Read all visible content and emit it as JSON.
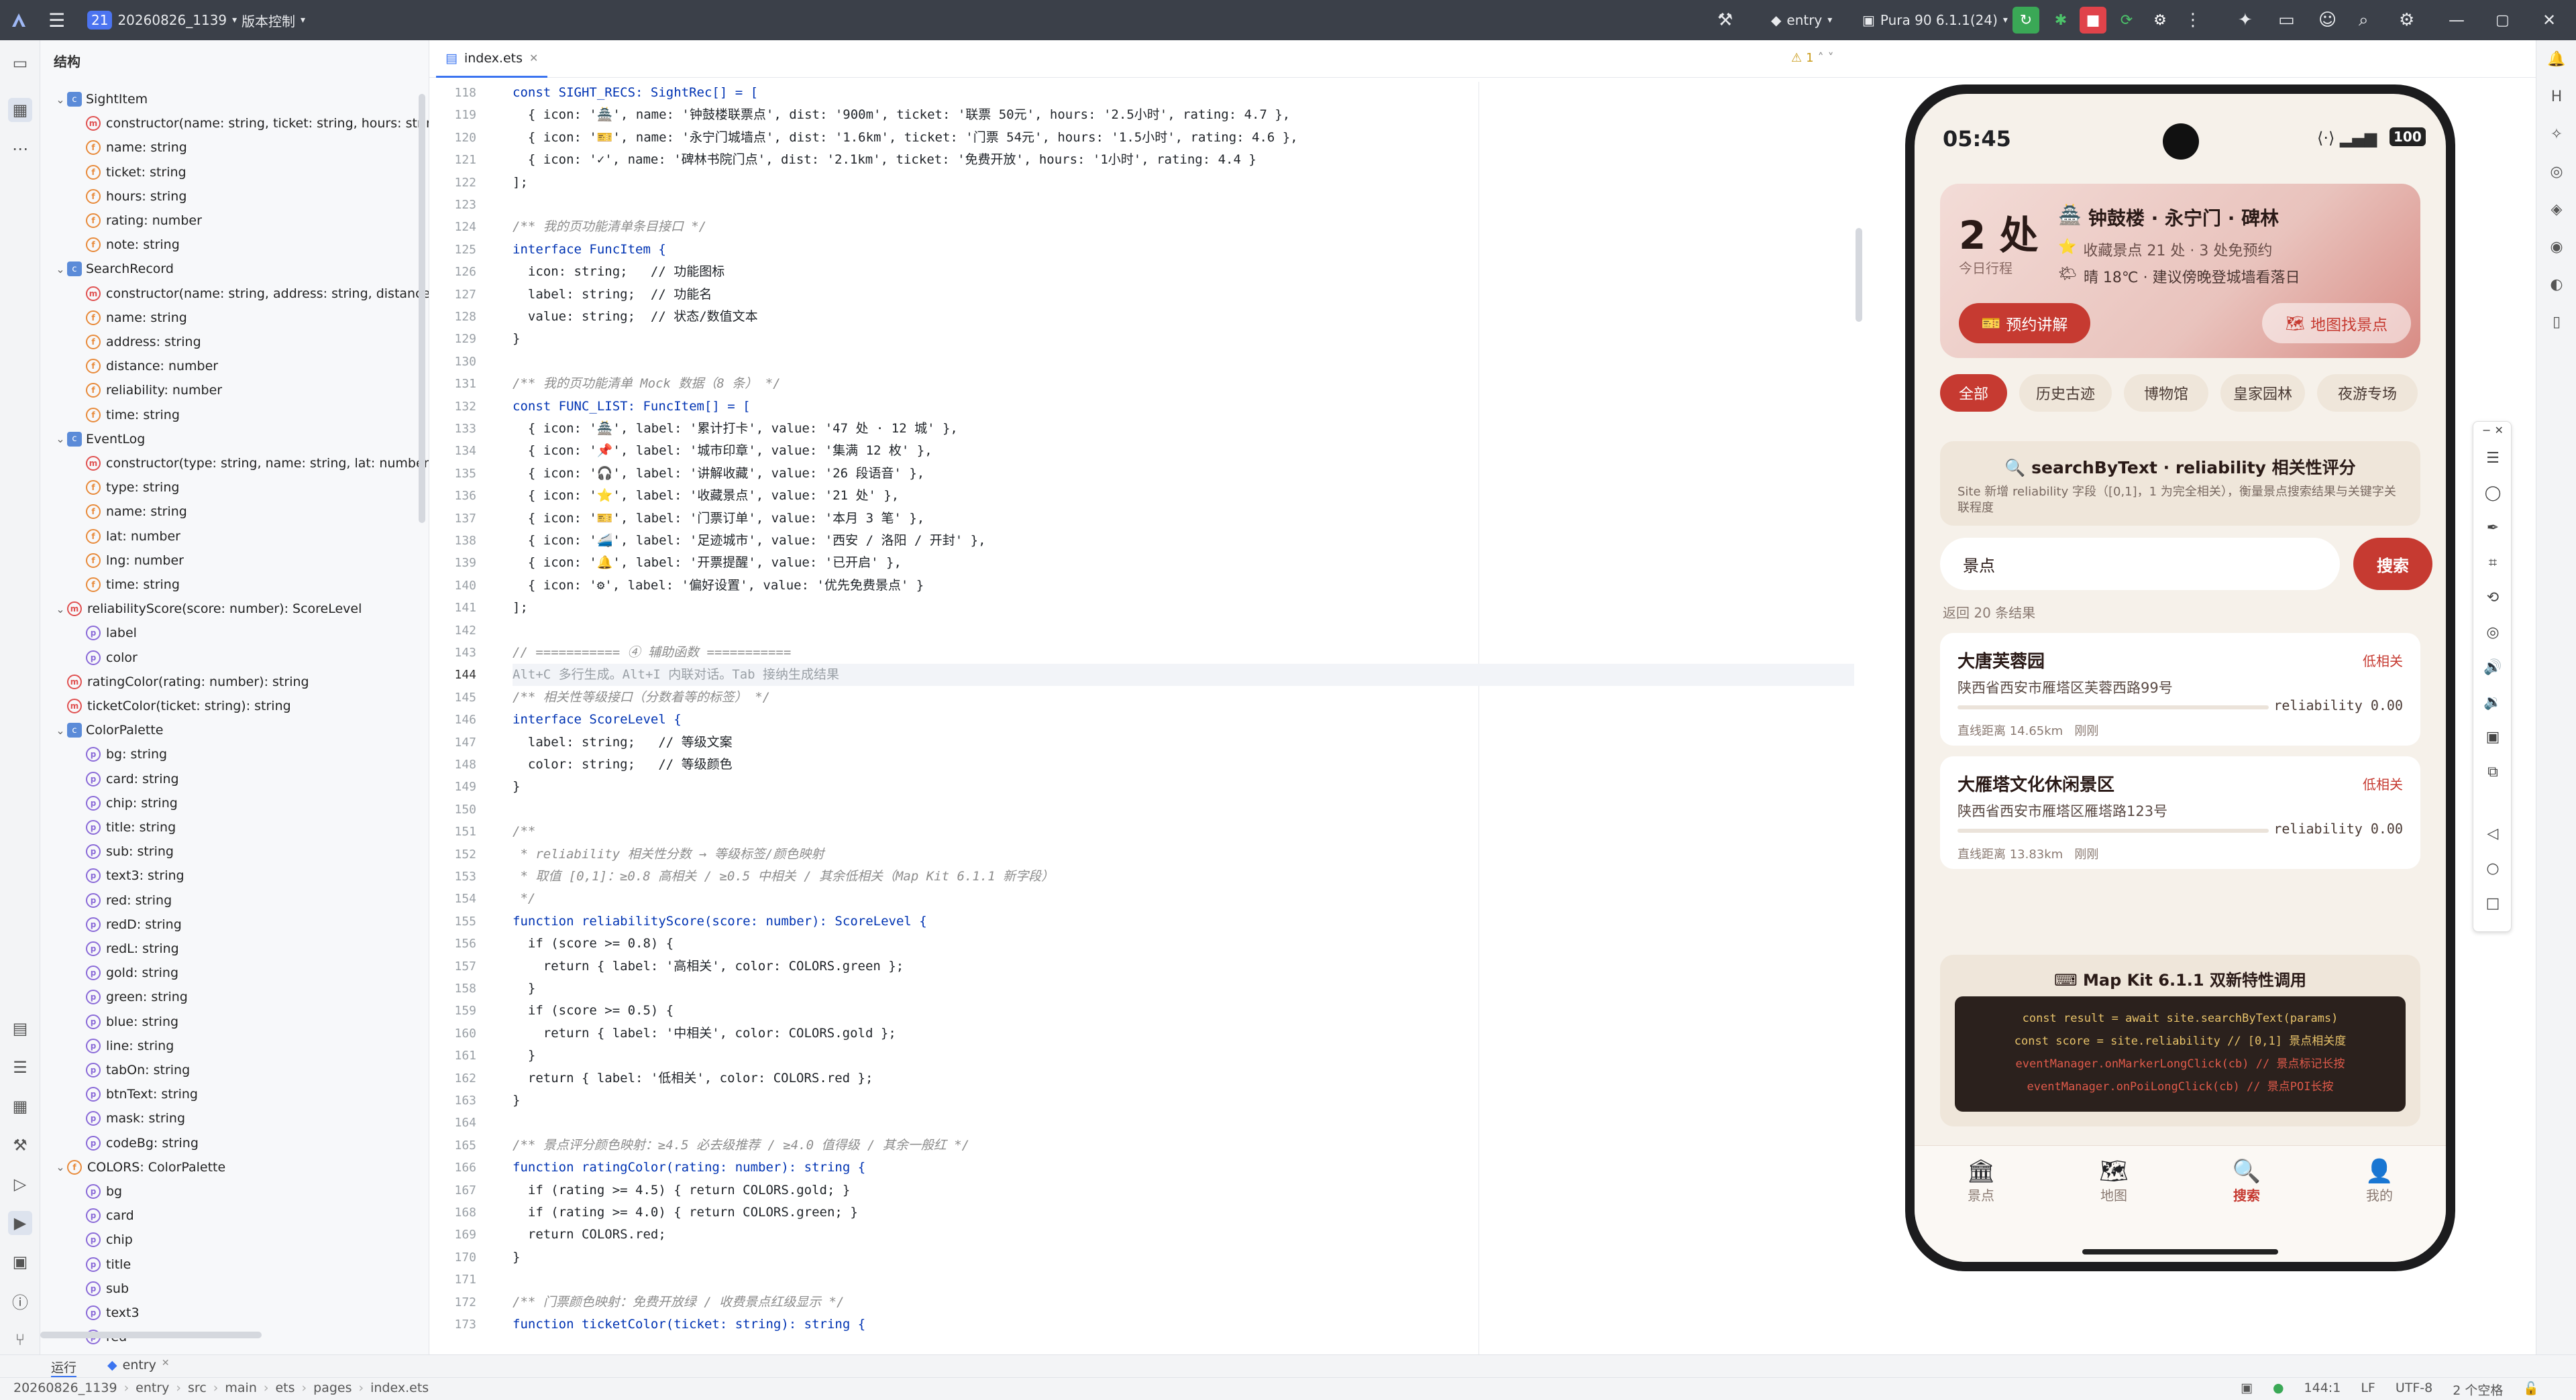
{
  "topbar": {
    "project_badge": "21",
    "project_name": "20260826_1139",
    "vcs": "版本控制",
    "module": "entry",
    "device": "Pura 90 6.1.1(24)"
  },
  "structure_panel": {
    "title": "结构",
    "rows": [
      {
        "indent": 0,
        "arrow": "⌄",
        "badge": "c",
        "text": "SightItem"
      },
      {
        "indent": 1,
        "arrow": "",
        "badge": "m",
        "text": "constructor(name: string, ticket: string, hours: string,"
      },
      {
        "indent": 1,
        "arrow": "",
        "badge": "f",
        "text": "name: string"
      },
      {
        "indent": 1,
        "arrow": "",
        "badge": "f",
        "text": "ticket: string"
      },
      {
        "indent": 1,
        "arrow": "",
        "badge": "f",
        "text": "hours: string"
      },
      {
        "indent": 1,
        "arrow": "",
        "badge": "f",
        "text": "rating: number"
      },
      {
        "indent": 1,
        "arrow": "",
        "badge": "f",
        "text": "note: string"
      },
      {
        "indent": 0,
        "arrow": "⌄",
        "badge": "c",
        "text": "SearchRecord"
      },
      {
        "indent": 1,
        "arrow": "",
        "badge": "m",
        "text": "constructor(name: string, address: string, distance: n"
      },
      {
        "indent": 1,
        "arrow": "",
        "badge": "f",
        "text": "name: string"
      },
      {
        "indent": 1,
        "arrow": "",
        "badge": "f",
        "text": "address: string"
      },
      {
        "indent": 1,
        "arrow": "",
        "badge": "f",
        "text": "distance: number"
      },
      {
        "indent": 1,
        "arrow": "",
        "badge": "f",
        "text": "reliability: number"
      },
      {
        "indent": 1,
        "arrow": "",
        "badge": "f",
        "text": "time: string"
      },
      {
        "indent": 0,
        "arrow": "⌄",
        "badge": "c",
        "text": "EventLog"
      },
      {
        "indent": 1,
        "arrow": "",
        "badge": "m",
        "text": "constructor(type: string, name: string, lat: number, ln"
      },
      {
        "indent": 1,
        "arrow": "",
        "badge": "f",
        "text": "type: string"
      },
      {
        "indent": 1,
        "arrow": "",
        "badge": "f",
        "text": "name: string"
      },
      {
        "indent": 1,
        "arrow": "",
        "badge": "f",
        "text": "lat: number"
      },
      {
        "indent": 1,
        "arrow": "",
        "badge": "f",
        "text": "lng: number"
      },
      {
        "indent": 1,
        "arrow": "",
        "badge": "f",
        "text": "time: string"
      },
      {
        "indent": 0,
        "arrow": "⌄",
        "badge": "m",
        "text": "reliabilityScore(score: number): ScoreLevel"
      },
      {
        "indent": 1,
        "arrow": "",
        "badge": "p",
        "text": "label"
      },
      {
        "indent": 1,
        "arrow": "",
        "badge": "p",
        "text": "color"
      },
      {
        "indent": 0,
        "arrow": "",
        "badge": "m",
        "text": "ratingColor(rating: number): string"
      },
      {
        "indent": 0,
        "arrow": "",
        "badge": "m",
        "text": "ticketColor(ticket: string): string"
      },
      {
        "indent": 0,
        "arrow": "⌄",
        "badge": "c",
        "text": "ColorPalette"
      },
      {
        "indent": 1,
        "arrow": "",
        "badge": "p",
        "text": "bg: string"
      },
      {
        "indent": 1,
        "arrow": "",
        "badge": "p",
        "text": "card: string"
      },
      {
        "indent": 1,
        "arrow": "",
        "badge": "p",
        "text": "chip: string"
      },
      {
        "indent": 1,
        "arrow": "",
        "badge": "p",
        "text": "title: string"
      },
      {
        "indent": 1,
        "arrow": "",
        "badge": "p",
        "text": "sub: string"
      },
      {
        "indent": 1,
        "arrow": "",
        "badge": "p",
        "text": "text3: string"
      },
      {
        "indent": 1,
        "arrow": "",
        "badge": "p",
        "text": "red: string"
      },
      {
        "indent": 1,
        "arrow": "",
        "badge": "p",
        "text": "redD: string"
      },
      {
        "indent": 1,
        "arrow": "",
        "badge": "p",
        "text": "redL: string"
      },
      {
        "indent": 1,
        "arrow": "",
        "badge": "p",
        "text": "gold: string"
      },
      {
        "indent": 1,
        "arrow": "",
        "badge": "p",
        "text": "green: string"
      },
      {
        "indent": 1,
        "arrow": "",
        "badge": "p",
        "text": "blue: string"
      },
      {
        "indent": 1,
        "arrow": "",
        "badge": "p",
        "text": "line: string"
      },
      {
        "indent": 1,
        "arrow": "",
        "badge": "p",
        "text": "tabOn: string"
      },
      {
        "indent": 1,
        "arrow": "",
        "badge": "p",
        "text": "btnText: string"
      },
      {
        "indent": 1,
        "arrow": "",
        "badge": "p",
        "text": "mask: string"
      },
      {
        "indent": 1,
        "arrow": "",
        "badge": "p",
        "text": "codeBg: string"
      },
      {
        "indent": 0,
        "arrow": "⌄",
        "badge": "f",
        "text": "COLORS: ColorPalette"
      },
      {
        "indent": 1,
        "arrow": "",
        "badge": "p",
        "text": "bg"
      },
      {
        "indent": 1,
        "arrow": "",
        "badge": "p",
        "text": "card"
      },
      {
        "indent": 1,
        "arrow": "",
        "badge": "p",
        "text": "chip"
      },
      {
        "indent": 1,
        "arrow": "",
        "badge": "p",
        "text": "title"
      },
      {
        "indent": 1,
        "arrow": "",
        "badge": "p",
        "text": "sub"
      },
      {
        "indent": 1,
        "arrow": "",
        "badge": "p",
        "text": "text3"
      },
      {
        "indent": 1,
        "arrow": "",
        "badge": "p",
        "text": "red"
      }
    ]
  },
  "editor": {
    "tab_label": "index.ets",
    "warning_count": "1",
    "lines": [
      {
        "n": "118",
        "t": "const SIGHT_RECS: SightRec[] = ["
      },
      {
        "n": "119",
        "t": "  { icon: '🏯', name: '钟鼓楼联票点', dist: '900m', ticket: '联票 50元', hours: '2.5小时', rating: 4.7 },"
      },
      {
        "n": "120",
        "t": "  { icon: '🎫', name: '永宁门城墙点', dist: '1.6km', ticket: '门票 54元', hours: '1.5小时', rating: 4.6 },"
      },
      {
        "n": "121",
        "t": "  { icon: '✓', name: '碑林书院门点', dist: '2.1km', ticket: '免费开放', hours: '1小时', rating: 4.4 }"
      },
      {
        "n": "122",
        "t": "];"
      },
      {
        "n": "123",
        "t": ""
      },
      {
        "n": "124",
        "t": "/** 我的页功能清单条目接口 */"
      },
      {
        "n": "125",
        "t": "interface FuncItem {"
      },
      {
        "n": "126",
        "t": "  icon: string;   // 功能图标"
      },
      {
        "n": "127",
        "t": "  label: string;  // 功能名"
      },
      {
        "n": "128",
        "t": "  value: string;  // 状态/数值文本"
      },
      {
        "n": "129",
        "t": "}"
      },
      {
        "n": "130",
        "t": ""
      },
      {
        "n": "131",
        "t": "/** 我的页功能清单 Mock 数据（8 条） */"
      },
      {
        "n": "132",
        "t": "const FUNC_LIST: FuncItem[] = ["
      },
      {
        "n": "133",
        "t": "  { icon: '🏯', label: '累计打卡', value: '47 处 · 12 城' },"
      },
      {
        "n": "134",
        "t": "  { icon: '📌', label: '城市印章', value: '集满 12 枚' },"
      },
      {
        "n": "135",
        "t": "  { icon: '🎧', label: '讲解收藏', value: '26 段语音' },"
      },
      {
        "n": "136",
        "t": "  { icon: '⭐', label: '收藏景点', value: '21 处' },"
      },
      {
        "n": "137",
        "t": "  { icon: '🎫', label: '门票订单', value: '本月 3 笔' },"
      },
      {
        "n": "138",
        "t": "  { icon: '🚄', label: '足迹城市', value: '西安 / 洛阳 / 开封' },"
      },
      {
        "n": "139",
        "t": "  { icon: '🔔', label: '开票提醒', value: '已开启' },"
      },
      {
        "n": "140",
        "t": "  { icon: '⚙', label: '偏好设置', value: '优先免费景点' }"
      },
      {
        "n": "141",
        "t": "];"
      },
      {
        "n": "142",
        "t": ""
      },
      {
        "n": "143",
        "t": "// =========== ④ 辅助函数 ==========="
      },
      {
        "n": "144",
        "t": "Alt+C 多行生成。Alt+I 内联对话。Tab 接纳生成结果"
      },
      {
        "n": "145",
        "t": "/** 相关性等级接口（分数着等的标签） */"
      },
      {
        "n": "146",
        "t": "interface ScoreLevel {"
      },
      {
        "n": "147",
        "t": "  label: string;   // 等级文案"
      },
      {
        "n": "148",
        "t": "  color: string;   // 等级颜色"
      },
      {
        "n": "149",
        "t": "}"
      },
      {
        "n": "150",
        "t": ""
      },
      {
        "n": "151",
        "t": "/**"
      },
      {
        "n": "152",
        "t": " * reliability 相关性分数 → 等级标签/颜色映射"
      },
      {
        "n": "153",
        "t": " * 取值 [0,1]：≥0.8 高相关 / ≥0.5 中相关 / 其余低相关（Map Kit 6.1.1 新字段）"
      },
      {
        "n": "154",
        "t": " */"
      },
      {
        "n": "155",
        "t": "function reliabilityScore(score: number): ScoreLevel {"
      },
      {
        "n": "156",
        "t": "  if (score >= 0.8) {"
      },
      {
        "n": "157",
        "t": "    return { label: '高相关', color: COLORS.green };"
      },
      {
        "n": "158",
        "t": "  }"
      },
      {
        "n": "159",
        "t": "  if (score >= 0.5) {"
      },
      {
        "n": "160",
        "t": "    return { label: '中相关', color: COLORS.gold };"
      },
      {
        "n": "161",
        "t": "  }"
      },
      {
        "n": "162",
        "t": "  return { label: '低相关', color: COLORS.red };"
      },
      {
        "n": "163",
        "t": "}"
      },
      {
        "n": "164",
        "t": ""
      },
      {
        "n": "165",
        "t": "/** 景点评分颜色映射：≥4.5 必去级推荐 / ≥4.0 值得级 / 其余一般红 */"
      },
      {
        "n": "166",
        "t": "function ratingColor(rating: number): string {"
      },
      {
        "n": "167",
        "t": "  if (rating >= 4.5) { return COLORS.gold; }"
      },
      {
        "n": "168",
        "t": "  if (rating >= 4.0) { return COLORS.green; }"
      },
      {
        "n": "169",
        "t": "  return COLORS.red;"
      },
      {
        "n": "170",
        "t": "}"
      },
      {
        "n": "171",
        "t": ""
      },
      {
        "n": "172",
        "t": "/** 门票颜色映射：免费开放绿 / 收费景点红级显示 */"
      },
      {
        "n": "173",
        "t": "function ticketColor(ticket: string): string {"
      }
    ]
  },
  "phone": {
    "time": "05:45",
    "battery": "100",
    "hero": {
      "count": "2 处",
      "count_sub": "今日行程",
      "route": "钟鼓楼 · 永宁门 · 碑林",
      "fav": "收藏景点 21 处 · 3 处免预约",
      "weather": "晴 18℃ · 建议傍晚登城墙看落日",
      "btn_guide": "预约讲解",
      "btn_map": "地图找景点"
    },
    "chips": [
      "全部",
      "历史古迹",
      "博物馆",
      "皇家园林",
      "夜游专场"
    ],
    "search_card": {
      "title": "searchByText · reliability 相关性评分",
      "desc": "Site 新增 reliability 字段（[0,1]，1 为完全相关），衡量景点搜索结果与关键字关联程度",
      "input_value": "景点",
      "search_btn": "搜索",
      "result_count": "返回 20 条结果"
    },
    "results": [
      {
        "name": "大唐芙蓉园",
        "level": "低相关",
        "address": "陕西省西安市雁塔区芙蓉西路99号",
        "score": "reliability 0.00",
        "meta": "直线距离 14.65km   刚刚",
        "fill": 0.0
      },
      {
        "name": "大雁塔文化休闲景区",
        "level": "低相关",
        "address": "陕西省西安市雁塔区雁塔路123号",
        "score": "reliability 0.00",
        "meta": "直线距离 13.83km   刚刚",
        "fill": 0.0
      }
    ],
    "mapkit": {
      "title": "Map Kit 6.1.1 双新特性调用",
      "code": [
        "const result = await site.searchByText(params)",
        "const score = site.reliability  // [0,1] 景点相关度",
        "eventManager.onMarkerLongClick(cb)  // 景点标记长按",
        "eventManager.onPoiLongClick(cb)     // 景点POI长按"
      ]
    },
    "tabs": [
      {
        "icon": "🏛",
        "label": "景点"
      },
      {
        "icon": "🗺",
        "label": "地图"
      },
      {
        "icon": "🔍",
        "label": "搜索"
      },
      {
        "icon": "👤",
        "label": "我的"
      }
    ],
    "colors": {
      "red": "#c63a31",
      "gold": "#c49a2a",
      "green": "#3a8f52"
    }
  },
  "bottom": {
    "run_tab": "运行",
    "entry_tab": "entry",
    "breadcrumb": [
      "20260826_1139",
      "entry",
      "src",
      "main",
      "ets",
      "pages",
      "index.ets"
    ],
    "position": "144:1",
    "eol": "LF",
    "encoding": "UTF-8",
    "indent": "2 个空格"
  }
}
